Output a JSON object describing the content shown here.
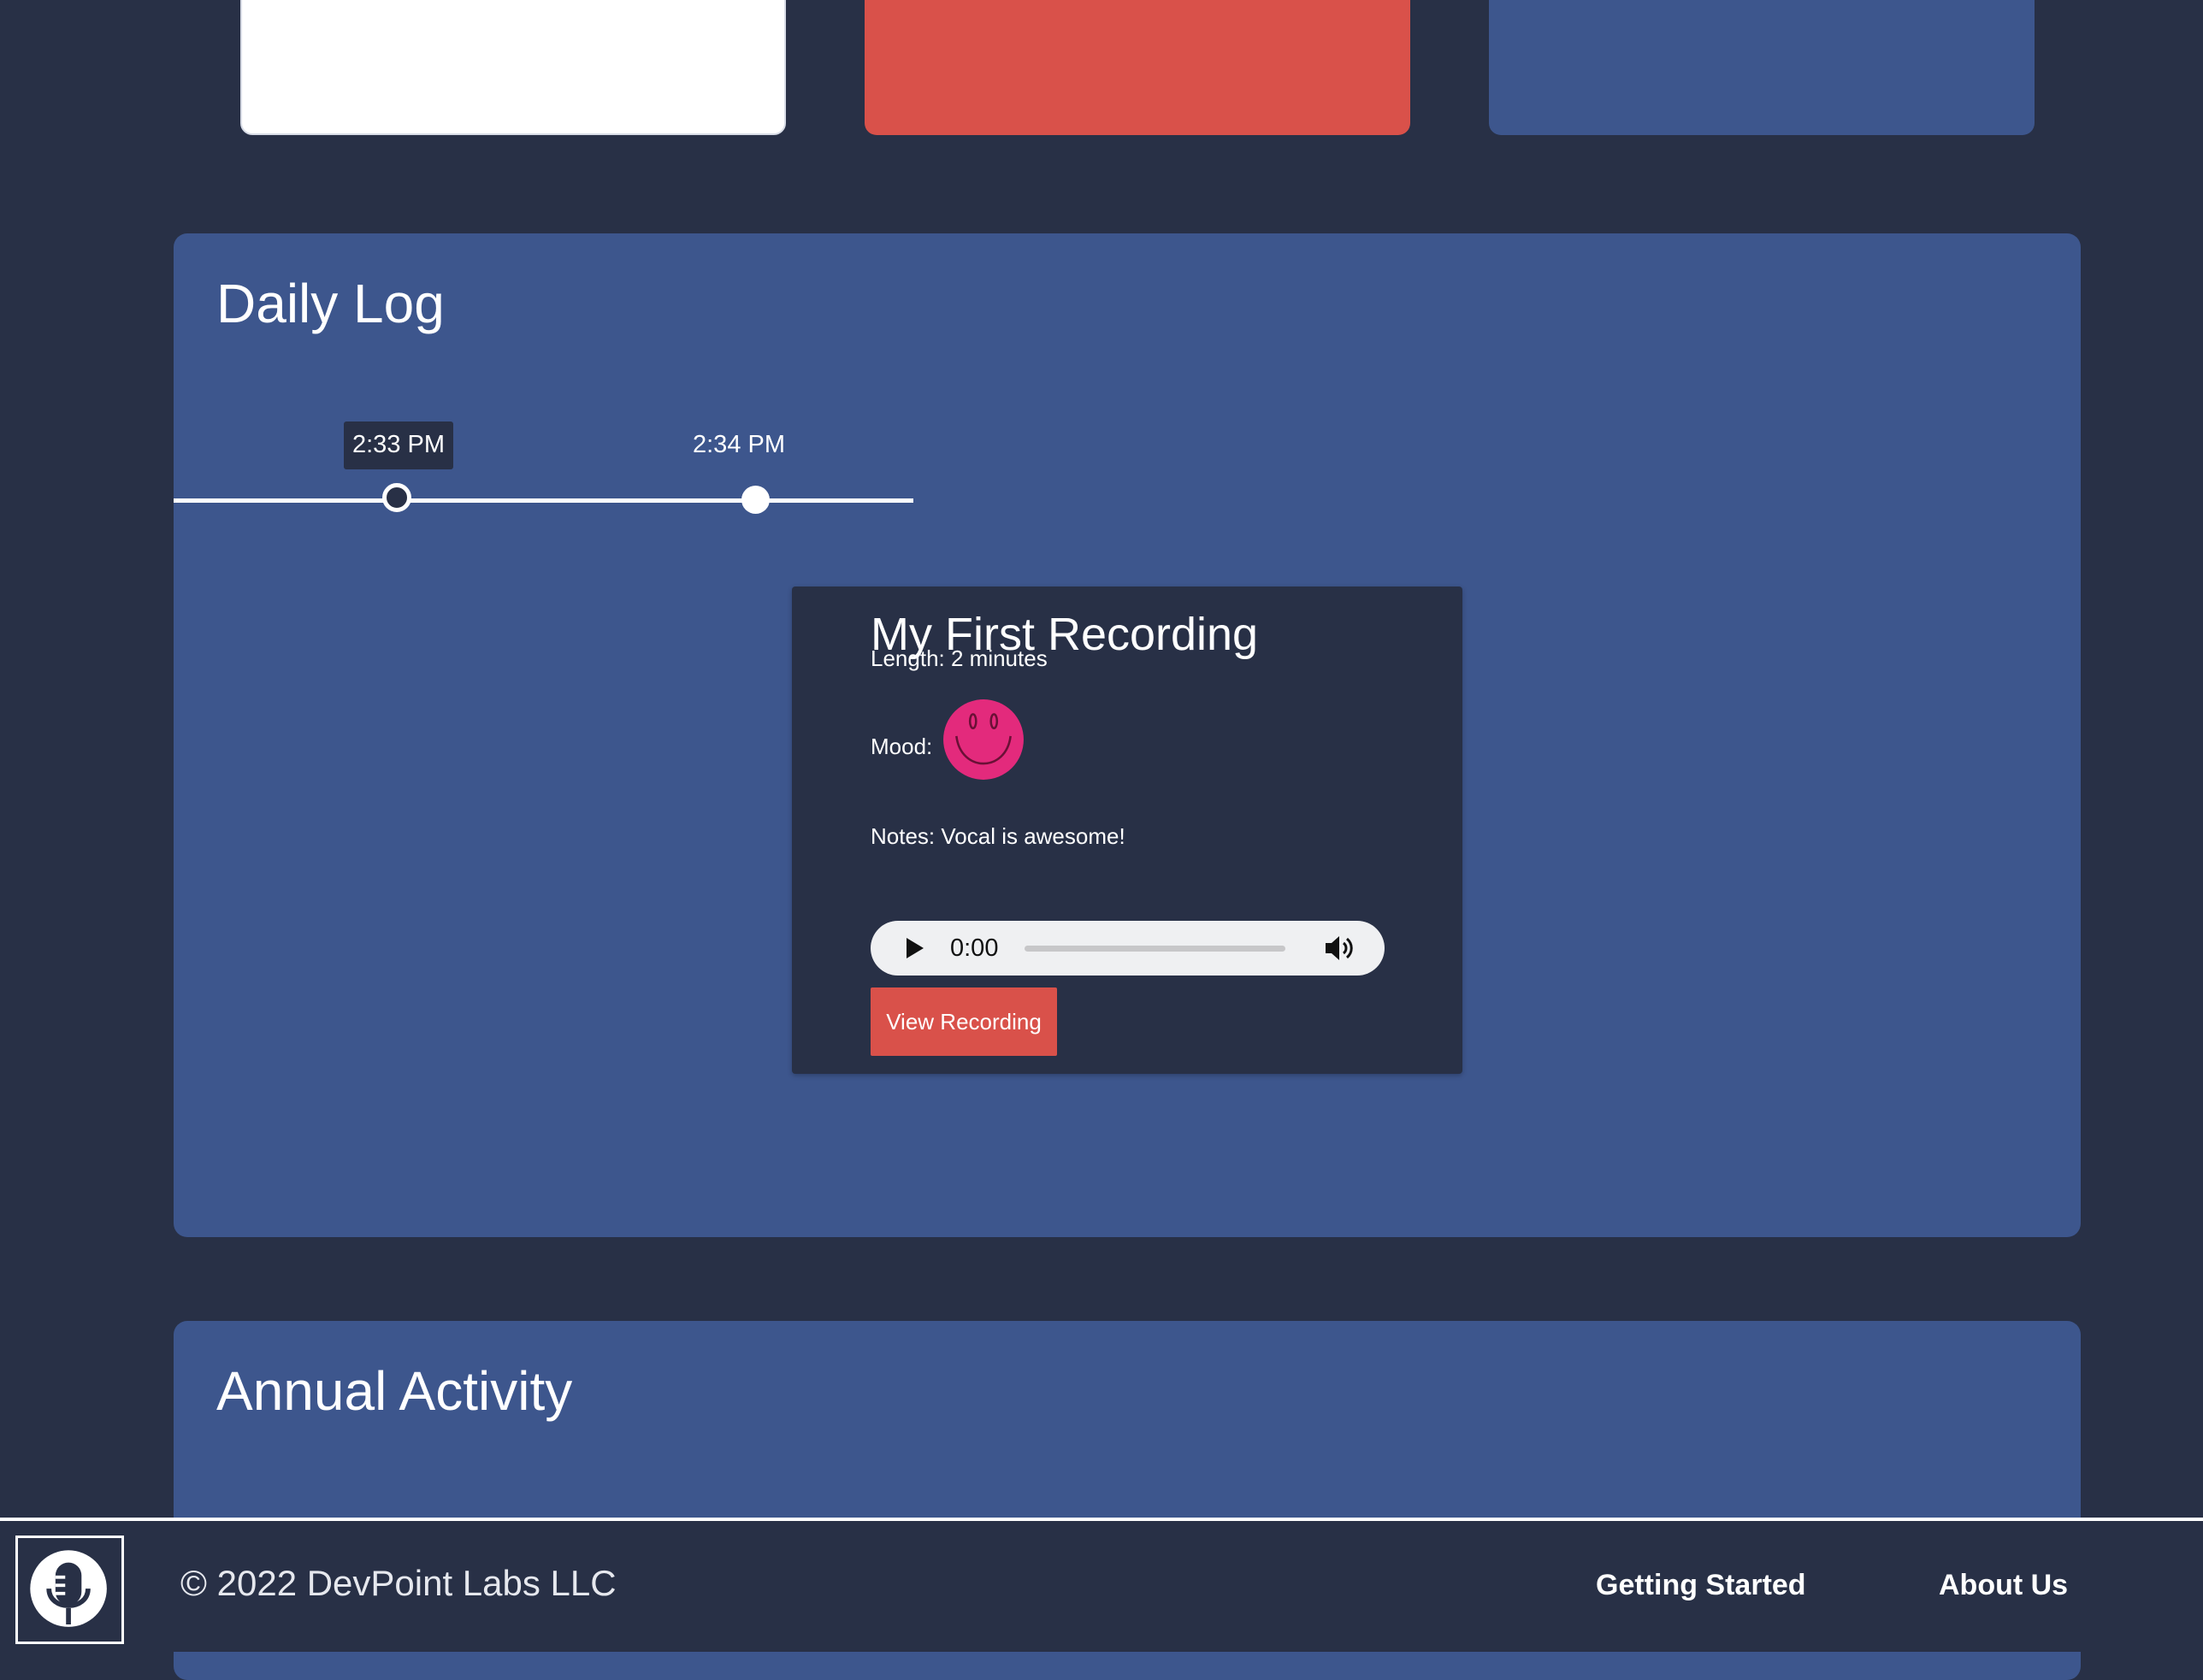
{
  "top_cards": {
    "colors": [
      "#ffffff",
      "#d9514a",
      "#3d568d"
    ]
  },
  "daily_log": {
    "title": "Daily Log",
    "timeline": [
      {
        "time": "2:33 PM",
        "active": true
      },
      {
        "time": "2:34 PM",
        "active": false
      }
    ],
    "recording": {
      "title": "My First Recording",
      "length": "Length: 2 minutes",
      "mood_label": "Mood:",
      "mood_icon": "smiley-face-icon",
      "notes": "Notes: Vocal is awesome!",
      "player": {
        "current_time": "0:00",
        "progress": 0
      },
      "view_button_label": "View Recording"
    }
  },
  "annual_activity": {
    "title": "Annual Activity"
  },
  "footer": {
    "logo_icon": "microphone-icon",
    "copyright": "© 2022 DevPoint Labs LLC",
    "links": [
      "Getting Started",
      "About Us"
    ]
  },
  "colors": {
    "background": "#283046",
    "panel": "#3d568d",
    "accent_red": "#d9514a",
    "mood_pink": "#e32a7c"
  }
}
